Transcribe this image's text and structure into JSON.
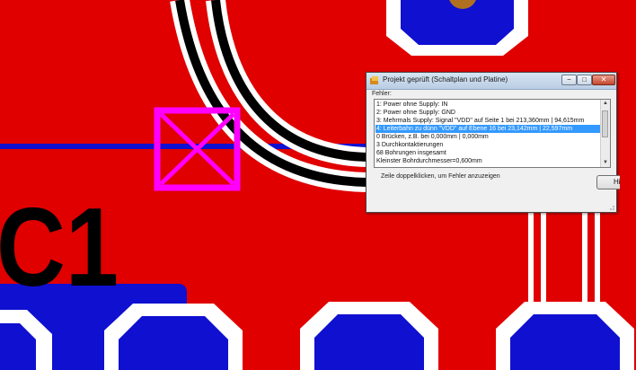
{
  "board": {
    "silkscreen_label": "C1",
    "colors": {
      "top_copper": "#e00000",
      "bottom_copper": "#1010d0",
      "pad_clearance": "#ffffff",
      "trace": "#000000",
      "marker": "#ff00ff",
      "drill": "#b07020"
    }
  },
  "dialog": {
    "title": "Projekt geprüft (Schaltplan und Platine)",
    "section_label": "Fehler:",
    "items": [
      "1: Power ohne Supply: IN",
      "2: Power ohne Supply: GND",
      "3: Mehrmals Supply:  Signal \"VDD\" auf Seite 1 bei 213,360mm | 94,615mm",
      "4: Leiterbahn zu dünn \"VDD\" auf Ebene 16 bei 23,142mm | 22,597mm",
      "0 Brücken, z.B. bei 0,000mm | 0,000mm",
      "3 Durchkontaktierungen",
      "68 Bohrungen insgesamt",
      "Kleinster Bohrdurchmesser=0,600mm"
    ],
    "selected_index": 3,
    "hint": "Zeile doppelklicken, um Fehler anzuzeigen",
    "help_button": "Hilfe",
    "window_buttons": {
      "minimize": "−",
      "maximize": "□",
      "close": "✕"
    }
  }
}
